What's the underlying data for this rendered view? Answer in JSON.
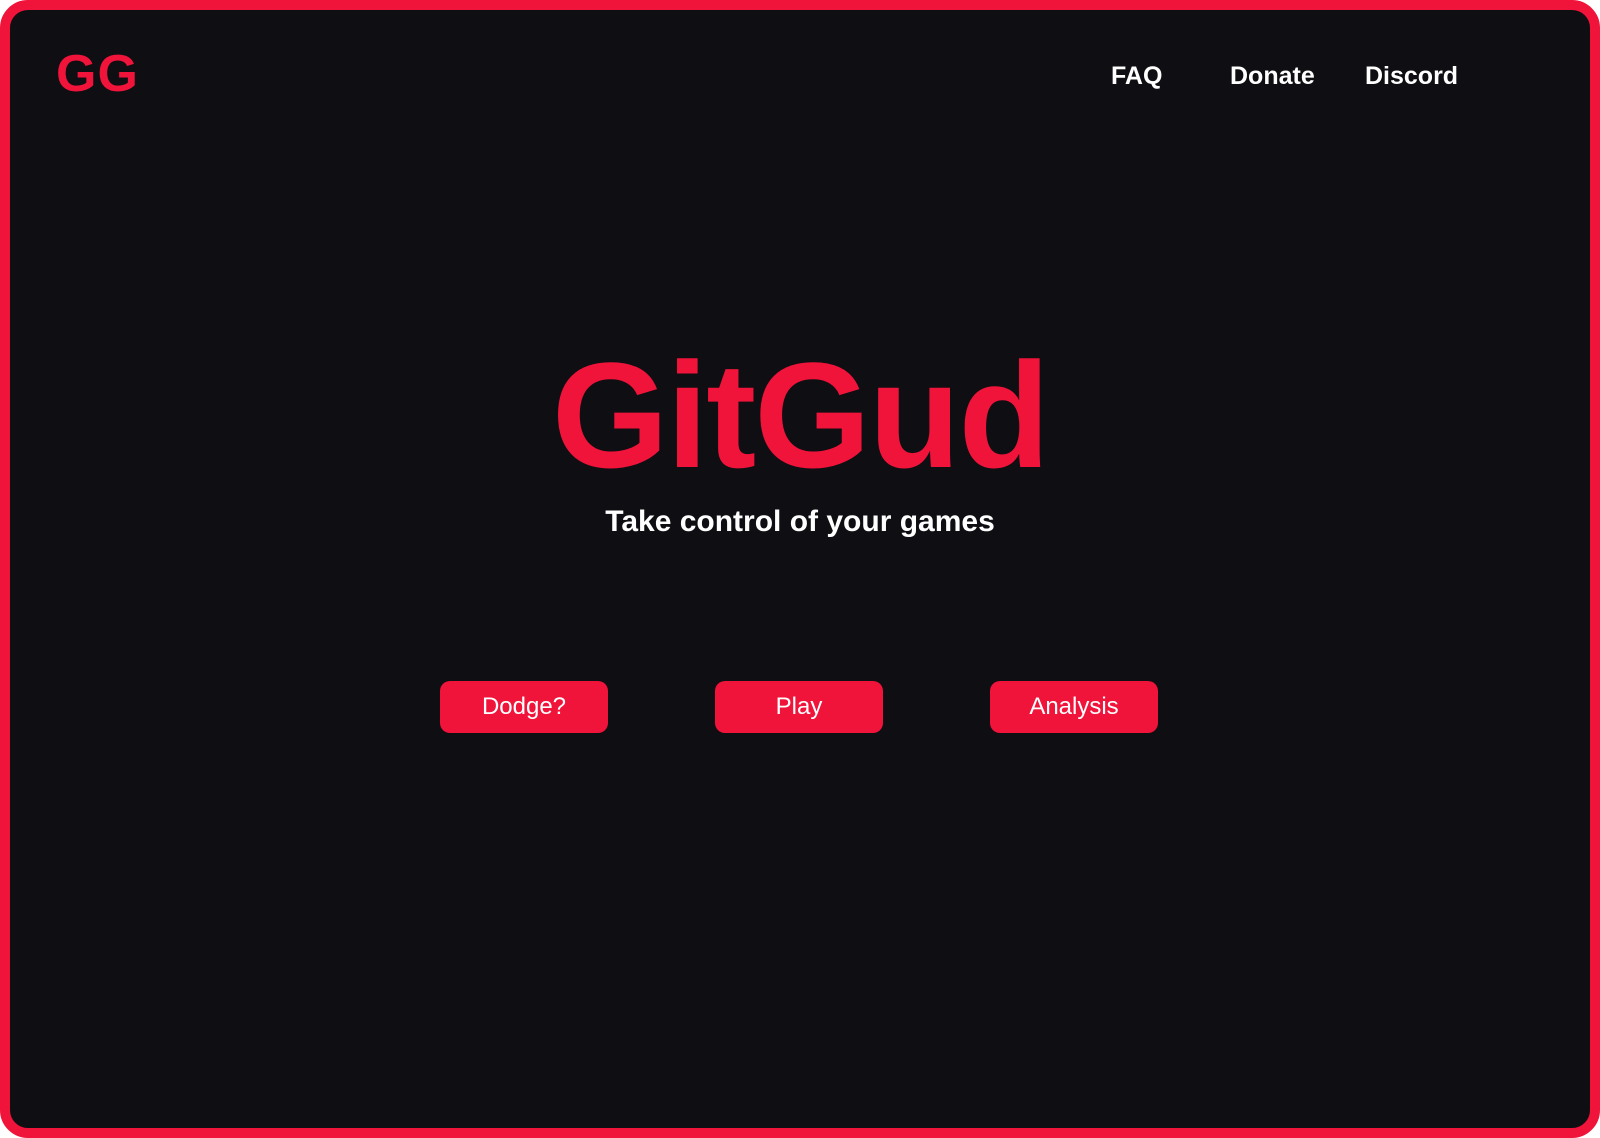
{
  "header": {
    "logo": "GG",
    "nav": {
      "faq": "FAQ",
      "donate": "Donate",
      "discord": "Discord"
    }
  },
  "hero": {
    "title": "GitGud",
    "subtitle": "Take control of your games"
  },
  "actions": {
    "dodge_label": "Dodge?",
    "play_label": "Play",
    "analysis_label": "Analysis"
  },
  "colors": {
    "accent": "#f0133a",
    "background": "#0e0e13",
    "text": "#ffffff"
  }
}
